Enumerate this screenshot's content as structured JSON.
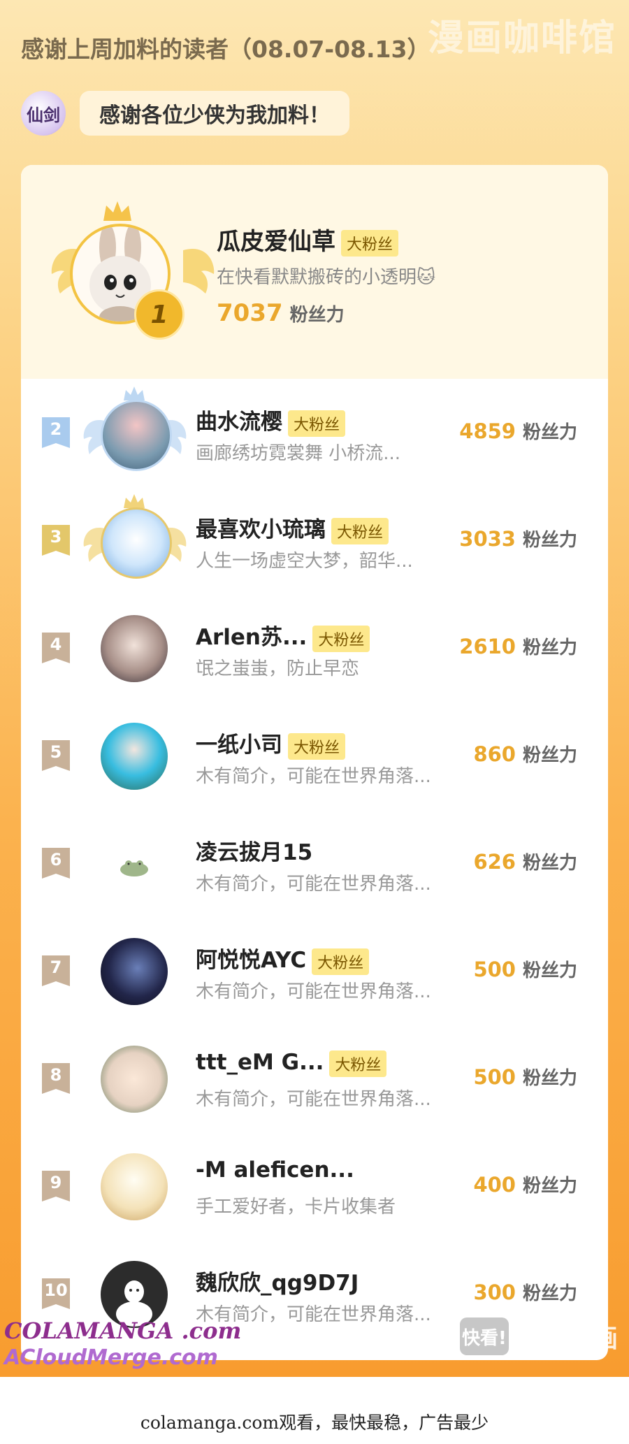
{
  "watermark_top": "漫画咖啡馆",
  "header": {
    "title": "感谢上周加料的读者（08.07-08.13）",
    "logo_text": "仙剑",
    "thanks": "感谢各位少侠为我加料！"
  },
  "top_fan": {
    "rank": "1",
    "name": "瓜皮爱仙草",
    "tag": "大粉丝",
    "bio": "在快看默默搬砖的小透明🐱",
    "score": "7037",
    "unit": "粉丝力"
  },
  "rankings": [
    {
      "rank": "2",
      "name": "曲水流樱",
      "tag": "大粉丝",
      "bio": "画廊绣坊霓裳舞 小桥流...",
      "score": "4859",
      "unit": "粉丝力"
    },
    {
      "rank": "3",
      "name": "最喜欢小琉璃",
      "tag": "大粉丝",
      "bio": "人生一场虚空大梦，韶华...",
      "score": "3033",
      "unit": "粉丝力"
    },
    {
      "rank": "4",
      "name": "Arlen苏...",
      "tag": "大粉丝",
      "bio": "氓之蚩蚩，防止早恋",
      "score": "2610",
      "unit": "粉丝力"
    },
    {
      "rank": "5",
      "name": "一纸小司",
      "tag": "大粉丝",
      "bio": "木有简介，可能在世界角落...",
      "score": "860",
      "unit": "粉丝力"
    },
    {
      "rank": "6",
      "name": "凌云拔月15",
      "tag": "",
      "bio": "木有简介，可能在世界角落...",
      "score": "626",
      "unit": "粉丝力"
    },
    {
      "rank": "7",
      "name": "阿悦悦AYC",
      "tag": "大粉丝",
      "bio": "木有简介，可能在世界角落...",
      "score": "500",
      "unit": "粉丝力"
    },
    {
      "rank": "8",
      "name": "ttt_eM G...",
      "tag": "大粉丝",
      "bio": "木有简介，可能在世界角落...",
      "score": "500",
      "unit": "粉丝力"
    },
    {
      "rank": "9",
      "name": "-M aleficen...",
      "tag": "",
      "bio": "手工爱好者，卡片收集者",
      "score": "400",
      "unit": "粉丝力"
    },
    {
      "rank": "10",
      "name": "魏欣欣_qg9D7J",
      "tag": "",
      "bio": "木有简介，可能在世界角落...",
      "score": "300",
      "unit": "粉丝力"
    }
  ],
  "watermarks": {
    "colamanga": "COLAMANGA .com",
    "acloud": "ACloudMerge.com",
    "kk_logo": "快看!",
    "kuaikan": "快看漫画"
  },
  "footer": "colamanga.com观看，最快最稳，广告最少",
  "colors": {
    "accent_gold": "#eaa72c",
    "tag_bg": "#fde88c",
    "rank2_flag": "#9fc3e8",
    "rank3_flag": "#e3c76a",
    "rank_other_flag": "#c8b199"
  }
}
